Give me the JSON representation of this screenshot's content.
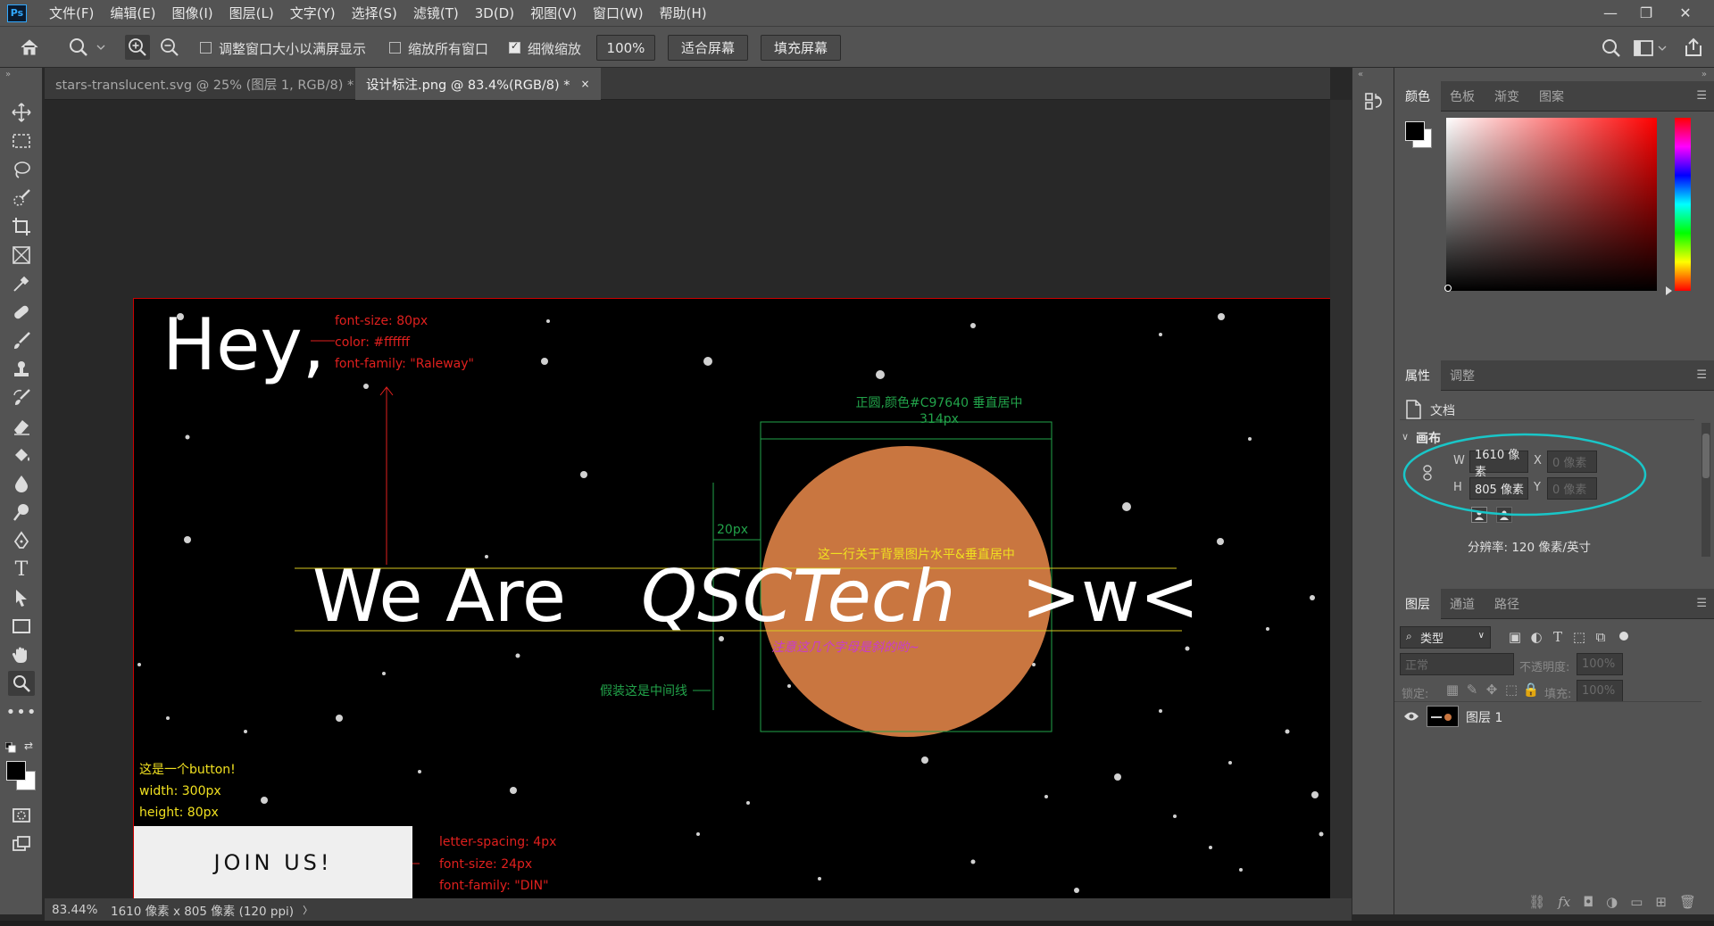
{
  "app": {
    "logo_text": "Ps"
  },
  "menu": [
    "文件(F)",
    "编辑(E)",
    "图像(I)",
    "图层(L)",
    "文字(Y)",
    "选择(S)",
    "滤镜(T)",
    "3D(D)",
    "视图(V)",
    "窗口(W)",
    "帮助(H)"
  ],
  "window_controls": {
    "minimize": "—",
    "restore": "❐",
    "close": "✕"
  },
  "options_bar": {
    "resize_windows_label": "调整窗口大小以满屏显示",
    "resize_windows_checked": false,
    "zoom_all_label": "缩放所有窗口",
    "zoom_all_checked": false,
    "scrubby_zoom_label": "细微缩放",
    "scrubby_zoom_checked": true,
    "zoom_value": "100%",
    "fit_screen_label": "适合屏幕",
    "fill_screen_label": "填充屏幕"
  },
  "tabs": [
    {
      "label": "stars-translucent.svg @ 25% (图层 1, RGB/8) *",
      "close": "×"
    },
    {
      "label": "设计标注.png @ 83.4%(RGB/8) *",
      "close": "×"
    }
  ],
  "canvas": {
    "hey": "Hey,",
    "ann_font": [
      "font-size: 80px",
      "color: #ffffff",
      "font-family: \"Raleway\""
    ],
    "ann_circle_1": "正圆,颜色#C97640 垂直居中",
    "ann_circle_2": "314px",
    "ann_20px": "20px",
    "ann_center": "这一行关于背景图片水平&垂直居中",
    "headline_1": "We Are",
    "headline_2": "QSCTech",
    "headline_3": ">w<",
    "ann_letters": "注意这几个字母是斜的哟~",
    "ann_midline": "假装这是中间线",
    "ann_button": [
      "这是一个button!",
      "width: 300px",
      "height: 80px"
    ],
    "button_label": "JOIN US!",
    "ann_button_font": [
      "letter-spacing: 4px",
      "font-size: 24px",
      "font-family: \"DIN\""
    ],
    "circle_color": "#C97640",
    "annotation_red": "#e0201e",
    "annotation_green": "#22a34a",
    "annotation_yellow": "#f0e020",
    "annotation_magenta": "#c83ccc"
  },
  "status": {
    "zoom": "83.44%",
    "doc_info": "1610 像素 x 805 像素 (120 ppi)",
    "arrow": "〉"
  },
  "color_panel": {
    "tabs": [
      "颜色",
      "色板",
      "渐变",
      "图案"
    ]
  },
  "properties_panel": {
    "tabs": [
      "属性",
      "调整"
    ],
    "doc_label": "文档",
    "section": "画布",
    "w_label": "W",
    "w_value": "1610 像素",
    "h_label": "H",
    "h_value": "805 像素",
    "x_label": "X",
    "x_placeholder": "0 像素",
    "y_label": "Y",
    "y_placeholder": "0 像素",
    "resolution": "分辨率: 120 像素/英寸"
  },
  "layers_panel": {
    "tabs": [
      "图层",
      "通道",
      "路径"
    ],
    "filter_label": "类型",
    "blend_mode": "正常",
    "opacity_label": "不透明度:",
    "opacity_value": "100%",
    "lock_label": "锁定:",
    "fill_label": "填充:",
    "fill_value": "100%",
    "layer_name": "图层 1"
  }
}
